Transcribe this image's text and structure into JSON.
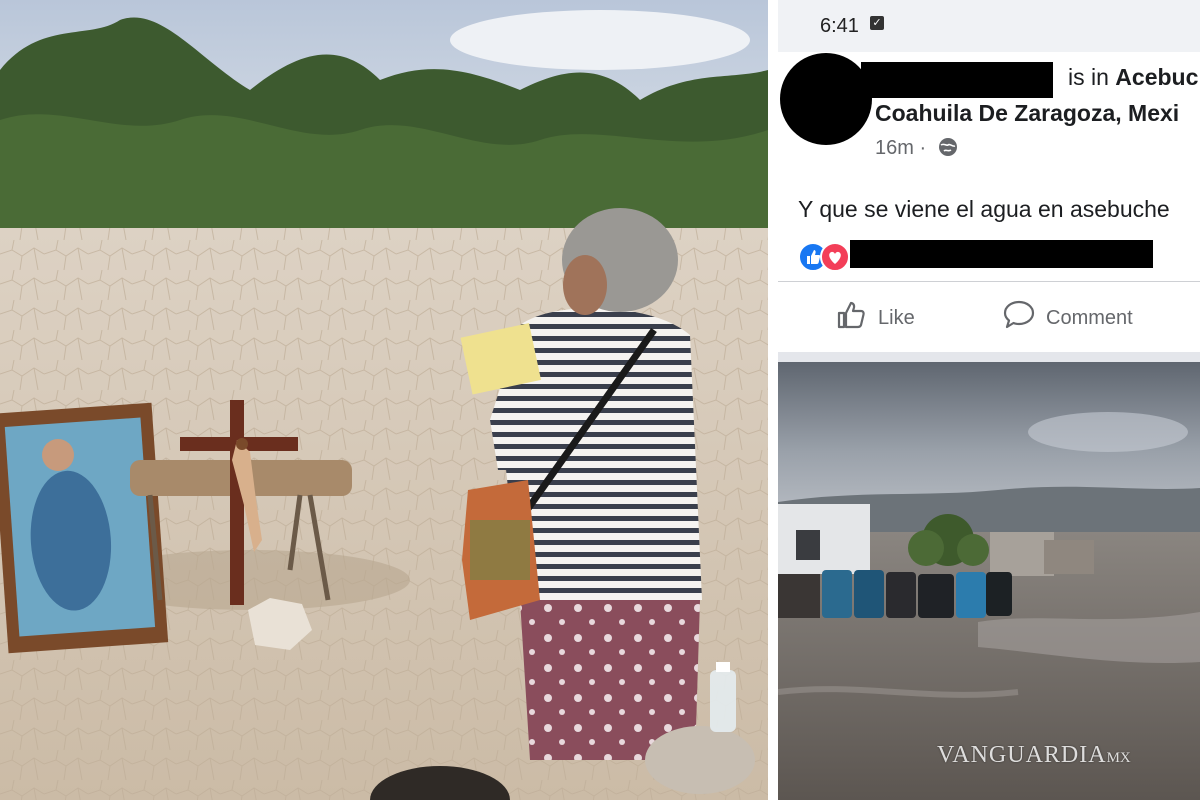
{
  "status_bar": {
    "time": "6:41"
  },
  "post": {
    "location_prefix": "is in",
    "location_name_part1": "Acebuc",
    "location_line2": "Coahuila De Zaragoza, Mexi",
    "time_ago": "16m",
    "separator_dot": "·",
    "text": "Y que se viene el agua en asebuche"
  },
  "actions": {
    "like_label": "Like",
    "comment_label": "Comment"
  },
  "watermark": {
    "brand": "VANGUARDIA",
    "suffix": "MX"
  },
  "colors": {
    "facebook_blue": "#1877f2",
    "love_red": "#f33e58",
    "secondary_text": "#65676b",
    "dry_ground": "#d9ccbc",
    "storm_sky": "#8a9099"
  },
  "icons": {
    "privacy": "globe-icon",
    "like": "thumbs-up-icon",
    "comment": "speech-bubble-icon",
    "status": "check-square-icon"
  }
}
